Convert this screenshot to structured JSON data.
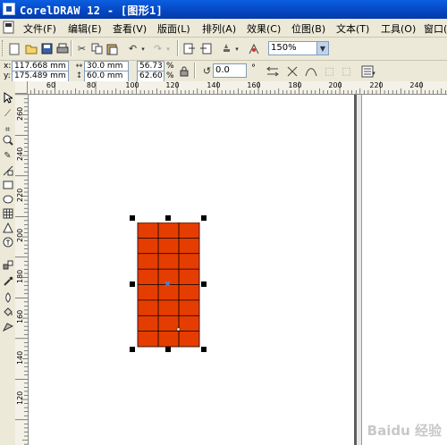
{
  "titlebar": {
    "title": "CorelDRAW 12 - [图形1]"
  },
  "menu": {
    "items": [
      "文件(F)",
      "编辑(E)",
      "查看(V)",
      "版面(L)",
      "排列(A)",
      "效果(C)",
      "位图(B)",
      "文本(T)",
      "工具(O)",
      "窗口("
    ]
  },
  "standard_toolbar": {
    "zoom_value": "150%"
  },
  "property_bar": {
    "x_label": "x:",
    "y_label": "y:",
    "x_value": "117.668 mm",
    "y_value": "175.489 mm",
    "width_value": "30.0 mm",
    "height_value": "60.0 mm",
    "scale_x_value": "56.73",
    "scale_y_value": "62.60",
    "percent_symbol_1": "%",
    "percent_symbol_2": "%",
    "rotation_value": "0.0",
    "degree_symbol": "°"
  },
  "rulers": {
    "horizontal_labels": [
      "60",
      "80",
      "100",
      "120",
      "140",
      "160",
      "180",
      "200",
      "220",
      "240"
    ],
    "vertical_labels": [
      "260",
      "240",
      "220",
      "200",
      "180",
      "160",
      "140",
      "120"
    ]
  },
  "drawing": {
    "fill_color": "#e53d00",
    "grid_rows": 8,
    "grid_cols": 3,
    "page_border_color": "#5e5e5e"
  },
  "watermark": {
    "text": "Baidu 经验"
  }
}
